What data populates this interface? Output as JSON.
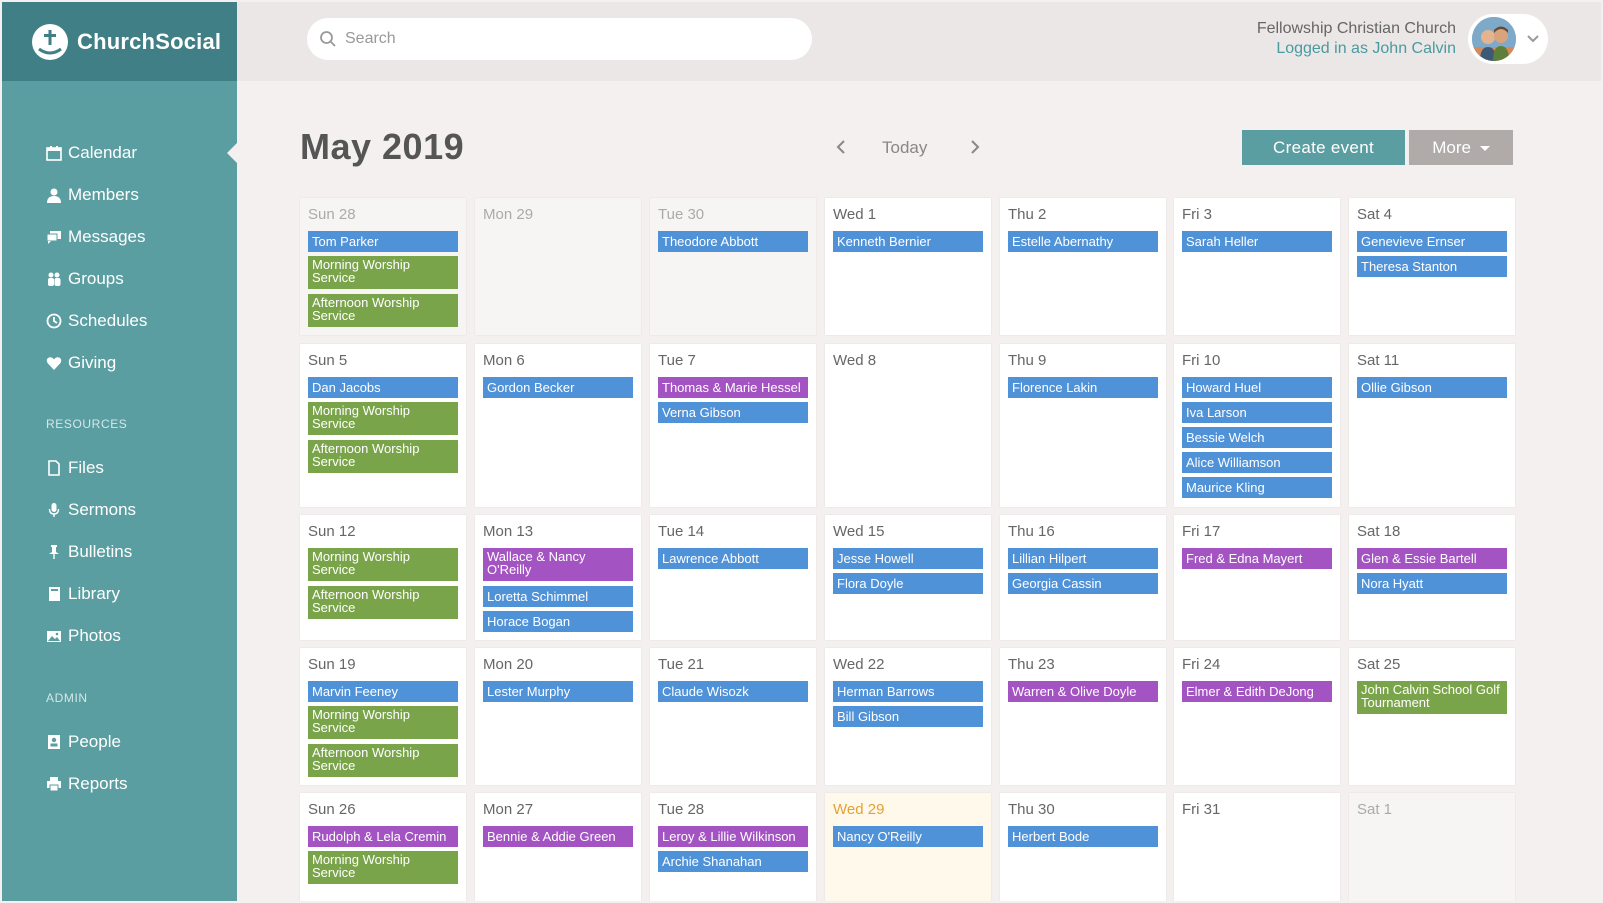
{
  "brand": {
    "name": "ChurchSocial"
  },
  "sidebar": {
    "items": [
      {
        "label": "Calendar",
        "icon": "calendar-icon"
      },
      {
        "label": "Members",
        "icon": "person-icon"
      },
      {
        "label": "Messages",
        "icon": "chat-icon"
      },
      {
        "label": "Groups",
        "icon": "group-icon"
      },
      {
        "label": "Schedules",
        "icon": "clock-icon"
      },
      {
        "label": "Giving",
        "icon": "heart-icon"
      }
    ],
    "resources_title": "RESOURCES",
    "resources": [
      {
        "label": "Files",
        "icon": "file-icon"
      },
      {
        "label": "Sermons",
        "icon": "microphone-icon"
      },
      {
        "label": "Bulletins",
        "icon": "pin-icon"
      },
      {
        "label": "Library",
        "icon": "book-icon"
      },
      {
        "label": "Photos",
        "icon": "image-icon"
      }
    ],
    "admin_title": "ADMIN",
    "admin": [
      {
        "label": "People",
        "icon": "address-book-icon"
      },
      {
        "label": "Reports",
        "icon": "printer-icon"
      }
    ]
  },
  "header": {
    "search_placeholder": "Search",
    "org_name": "Fellowship Christian Church",
    "logged_in": "Logged in as John Calvin"
  },
  "calendar": {
    "title": "May 2019",
    "today_label": "Today",
    "create_label": "Create event",
    "more_label": "More",
    "weeks": [
      [
        {
          "label": "Sun 28",
          "state": "other",
          "events": [
            {
              "t": "Tom Parker",
              "c": "blue"
            },
            {
              "t": "Morning Worship Service",
              "c": "green"
            },
            {
              "t": "Afternoon Worship Service",
              "c": "green"
            }
          ]
        },
        {
          "label": "Mon 29",
          "state": "other",
          "events": []
        },
        {
          "label": "Tue 30",
          "state": "other",
          "events": [
            {
              "t": "Theodore Abbott",
              "c": "blue"
            }
          ]
        },
        {
          "label": "Wed 1",
          "state": "",
          "events": [
            {
              "t": "Kenneth Bernier",
              "c": "blue"
            }
          ]
        },
        {
          "label": "Thu 2",
          "state": "",
          "events": [
            {
              "t": "Estelle Abernathy",
              "c": "blue"
            }
          ]
        },
        {
          "label": "Fri 3",
          "state": "",
          "events": [
            {
              "t": "Sarah Heller",
              "c": "blue"
            }
          ]
        },
        {
          "label": "Sat 4",
          "state": "",
          "events": [
            {
              "t": "Genevieve Ernser",
              "c": "blue"
            },
            {
              "t": "Theresa Stanton",
              "c": "blue"
            }
          ]
        }
      ],
      [
        {
          "label": "Sun 5",
          "state": "",
          "events": [
            {
              "t": "Dan Jacobs",
              "c": "blue"
            },
            {
              "t": "Morning Worship Service",
              "c": "green"
            },
            {
              "t": "Afternoon Worship Service",
              "c": "green"
            }
          ]
        },
        {
          "label": "Mon 6",
          "state": "",
          "events": [
            {
              "t": "Gordon Becker",
              "c": "blue"
            }
          ]
        },
        {
          "label": "Tue 7",
          "state": "",
          "events": [
            {
              "t": "Thomas & Marie Hessel",
              "c": "purple"
            },
            {
              "t": "Verna Gibson",
              "c": "blue"
            }
          ]
        },
        {
          "label": "Wed 8",
          "state": "",
          "events": []
        },
        {
          "label": "Thu 9",
          "state": "",
          "events": [
            {
              "t": "Florence Lakin",
              "c": "blue"
            }
          ]
        },
        {
          "label": "Fri 10",
          "state": "",
          "events": [
            {
              "t": "Howard Huel",
              "c": "blue"
            },
            {
              "t": "Iva Larson",
              "c": "blue"
            },
            {
              "t": "Bessie Welch",
              "c": "blue"
            },
            {
              "t": "Alice Williamson",
              "c": "blue"
            },
            {
              "t": "Maurice Kling",
              "c": "blue"
            }
          ]
        },
        {
          "label": "Sat 11",
          "state": "",
          "events": [
            {
              "t": "Ollie Gibson",
              "c": "blue"
            }
          ]
        }
      ],
      [
        {
          "label": "Sun 12",
          "state": "",
          "events": [
            {
              "t": "Morning Worship Service",
              "c": "green"
            },
            {
              "t": "Afternoon Worship Service",
              "c": "green"
            }
          ]
        },
        {
          "label": "Mon 13",
          "state": "",
          "events": [
            {
              "t": "Wallace & Nancy O'Reilly",
              "c": "purple tall"
            },
            {
              "t": "Loretta Schimmel",
              "c": "blue"
            },
            {
              "t": "Horace Bogan",
              "c": "blue"
            }
          ]
        },
        {
          "label": "Tue 14",
          "state": "",
          "events": [
            {
              "t": "Lawrence Abbott",
              "c": "blue"
            }
          ]
        },
        {
          "label": "Wed 15",
          "state": "",
          "events": [
            {
              "t": "Jesse Howell",
              "c": "blue"
            },
            {
              "t": "Flora Doyle",
              "c": "blue"
            }
          ]
        },
        {
          "label": "Thu 16",
          "state": "",
          "events": [
            {
              "t": "Lillian Hilpert",
              "c": "blue"
            },
            {
              "t": "Georgia Cassin",
              "c": "blue"
            }
          ]
        },
        {
          "label": "Fri 17",
          "state": "",
          "events": [
            {
              "t": "Fred & Edna Mayert",
              "c": "purple"
            }
          ]
        },
        {
          "label": "Sat 18",
          "state": "",
          "events": [
            {
              "t": "Glen & Essie Bartell",
              "c": "purple"
            },
            {
              "t": "Nora Hyatt",
              "c": "blue"
            }
          ]
        }
      ],
      [
        {
          "label": "Sun 19",
          "state": "",
          "events": [
            {
              "t": "Marvin Feeney",
              "c": "blue"
            },
            {
              "t": "Morning Worship Service",
              "c": "green"
            },
            {
              "t": "Afternoon Worship Service",
              "c": "green"
            }
          ]
        },
        {
          "label": "Mon 20",
          "state": "",
          "events": [
            {
              "t": "Lester Murphy",
              "c": "blue"
            }
          ]
        },
        {
          "label": "Tue 21",
          "state": "",
          "events": [
            {
              "t": "Claude Wisozk",
              "c": "blue"
            }
          ]
        },
        {
          "label": "Wed 22",
          "state": "",
          "events": [
            {
              "t": "Herman Barrows",
              "c": "blue"
            },
            {
              "t": "Bill Gibson",
              "c": "blue"
            }
          ]
        },
        {
          "label": "Thu 23",
          "state": "",
          "events": [
            {
              "t": "Warren & Olive Doyle",
              "c": "purple"
            }
          ]
        },
        {
          "label": "Fri 24",
          "state": "",
          "events": [
            {
              "t": "Elmer & Edith DeJong",
              "c": "purple"
            }
          ]
        },
        {
          "label": "Sat 25",
          "state": "",
          "events": [
            {
              "t": "John Calvin School Golf Tournament",
              "c": "green"
            }
          ]
        }
      ],
      [
        {
          "label": "Sun 26",
          "state": "",
          "events": [
            {
              "t": "Rudolph & Lela Cremin",
              "c": "purple"
            },
            {
              "t": "Morning Worship Service",
              "c": "green"
            }
          ]
        },
        {
          "label": "Mon 27",
          "state": "",
          "events": [
            {
              "t": "Bennie & Addie Green",
              "c": "purple"
            }
          ]
        },
        {
          "label": "Tue 28",
          "state": "",
          "events": [
            {
              "t": "Leroy & Lillie Wilkinson",
              "c": "purple"
            },
            {
              "t": "Archie Shanahan",
              "c": "blue"
            }
          ]
        },
        {
          "label": "Wed 29",
          "state": "today",
          "events": [
            {
              "t": "Nancy O'Reilly",
              "c": "blue"
            }
          ]
        },
        {
          "label": "Thu 30",
          "state": "",
          "events": [
            {
              "t": "Herbert Bode",
              "c": "blue"
            }
          ]
        },
        {
          "label": "Fri 31",
          "state": "",
          "events": []
        },
        {
          "label": "Sat 1",
          "state": "other",
          "events": []
        }
      ]
    ]
  },
  "colors": {
    "teal": "#5a9ea1",
    "teal_dark": "#3f7f85",
    "blue": "#5092d8",
    "green": "#7aa44a",
    "purple": "#a453c2"
  }
}
